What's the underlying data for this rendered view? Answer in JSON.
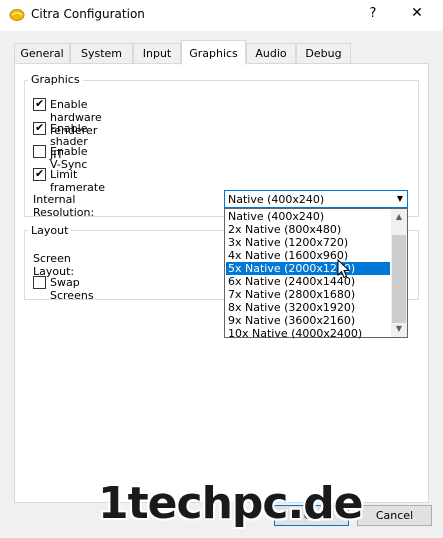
{
  "window": {
    "title": "Citra Configuration",
    "help_glyph": "?",
    "close_glyph": "✕"
  },
  "tabs": [
    {
      "label": "General"
    },
    {
      "label": "System"
    },
    {
      "label": "Input"
    },
    {
      "label": "Graphics",
      "active": true
    },
    {
      "label": "Audio"
    },
    {
      "label": "Debug"
    }
  ],
  "graphics": {
    "title": "Graphics",
    "checkboxes": [
      {
        "label": "Enable hardware renderer",
        "checked": true
      },
      {
        "label": "Enable shader JIT",
        "checked": true
      },
      {
        "label": "Enable V-Sync",
        "checked": false
      },
      {
        "label": "Limit framerate",
        "checked": true
      }
    ],
    "resolution_label": "Internal Resolution:",
    "resolution_value": "Native (400x240)",
    "resolution_options": [
      "Native (400x240)",
      "2x Native (800x480)",
      "3x Native (1200x720)",
      "4x Native (1600x960)",
      "5x Native (2000x1200)",
      "6x Native (2400x1440)",
      "7x Native (2800x1680)",
      "8x Native (3200x1920)",
      "9x Native (3600x2160)",
      "10x Native (4000x2400)"
    ],
    "highlighted_option_index": 4
  },
  "layout": {
    "title": "Layout",
    "screen_layout_label": "Screen Layout:",
    "swap_screens_label": "Swap Screens",
    "swap_screens_checked": false
  },
  "buttons": {
    "ok": "OK",
    "cancel": "Cancel"
  },
  "watermark": "1techpc.de",
  "colors": {
    "accent": "#0078d7",
    "dialog_bg": "#f0f0f0",
    "panel_bg": "#ffffff"
  }
}
